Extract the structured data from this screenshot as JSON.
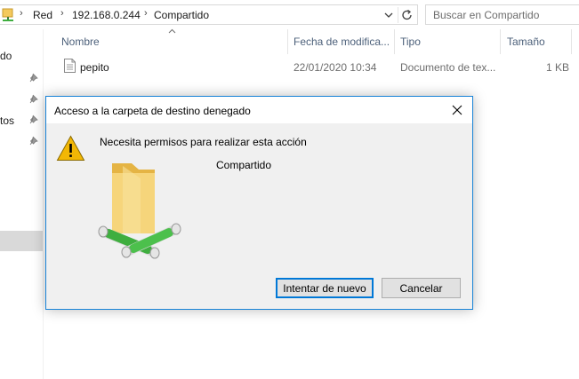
{
  "addressbar": {
    "crumbs": [
      "Red",
      "192.168.0.244",
      "Compartido"
    ],
    "search_placeholder": "Buscar en Compartido"
  },
  "navpane": {
    "partial_labels": [
      "do",
      "tos"
    ]
  },
  "filelist": {
    "columns": [
      "Nombre",
      "Fecha de modifica...",
      "Tipo",
      "Tamaño"
    ],
    "rows": [
      {
        "name": "pepito",
        "modified": "22/01/2020 10:34",
        "type": "Documento de tex...",
        "size": "1 KB"
      }
    ]
  },
  "dialog": {
    "title": "Acceso a la carpeta de destino denegado",
    "message": "Necesita permisos para realizar esta acción",
    "folder_name": "Compartido",
    "retry_label": "Intentar de nuevo",
    "cancel_label": "Cancelar"
  },
  "colors": {
    "accent": "#0078d7",
    "dialog_border": "#1883d7",
    "folder": "#f4c95d",
    "network_pipe": "#3fae3f",
    "warning": "#f2b705"
  },
  "icons": [
    "network-location-icon",
    "chevron-right-icon",
    "chevron-down-icon",
    "refresh-icon",
    "pin-icon",
    "text-file-icon",
    "close-icon",
    "warning-icon",
    "network-folder-icon",
    "sort-up-icon"
  ]
}
